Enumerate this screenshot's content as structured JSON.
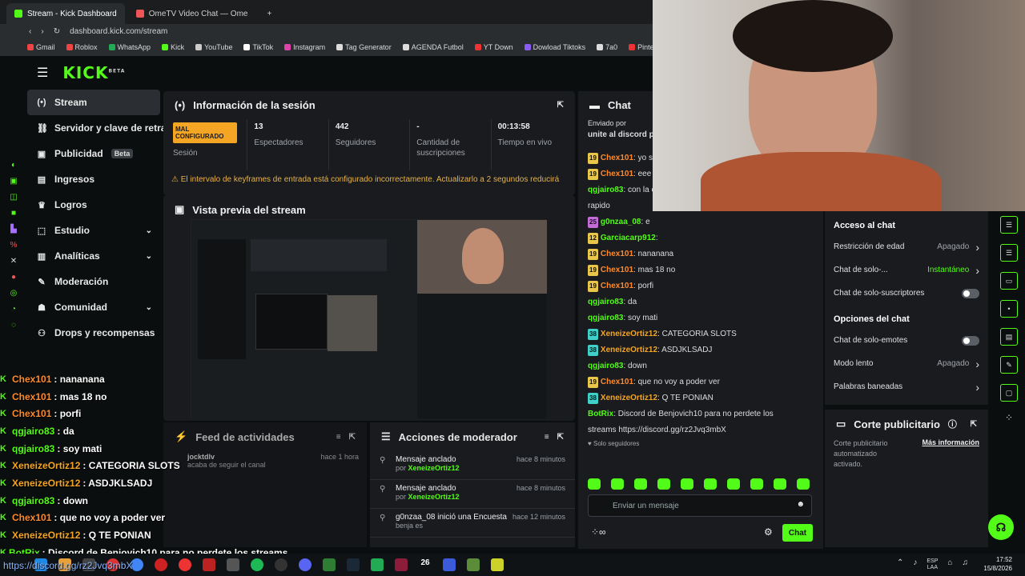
{
  "browser": {
    "tabs": [
      {
        "label": "Stream - Kick Dashboard"
      },
      {
        "label": "OmeTV Video Chat — Ome"
      }
    ],
    "url": "dashboard.kick.com/stream",
    "bookmarks": [
      "Gmail",
      "Roblox",
      "WhatsApp",
      "Kick",
      "YouTube",
      "TikTok",
      "Instagram",
      "Tag Generator",
      "AGENDA Futbol",
      "YT Down",
      "Dowload Tiktoks",
      "7a0",
      "Pinterest"
    ]
  },
  "kick": {
    "logo": "KICK",
    "beta": "BETA"
  },
  "sidebar": {
    "items": [
      {
        "label": "Stream",
        "icon": "broadcast-icon",
        "icon_glyph": "(•)"
      },
      {
        "label": "Servidor y clave de retransmisión",
        "icon": "link-icon",
        "icon_glyph": "⛓"
      },
      {
        "label": "Publicidad",
        "badge": "Beta",
        "icon": "ad-icon",
        "icon_glyph": "▣"
      },
      {
        "label": "Ingresos",
        "icon": "money-icon",
        "icon_glyph": "▤"
      },
      {
        "label": "Logros",
        "icon": "trophy-icon",
        "icon_glyph": "♛"
      },
      {
        "label": "Estudio",
        "icon": "studio-icon",
        "icon_glyph": "⬚"
      },
      {
        "label": "Analíticas",
        "icon": "analytics-icon",
        "icon_glyph": "▥"
      },
      {
        "label": "Moderación",
        "icon": "wrench-icon",
        "icon_glyph": "✎"
      },
      {
        "label": "Comunidad",
        "icon": "community-icon",
        "icon_glyph": "☗"
      },
      {
        "label": "Drops y recompensas",
        "icon": "drops-icon",
        "icon_glyph": "⚇"
      }
    ]
  },
  "session": {
    "title": "Información de la sesión",
    "status_badge": "MAL CONFIGURADO",
    "status_label": "Sesión",
    "stats": [
      {
        "value": "13",
        "label": "Espectadores"
      },
      {
        "value": "442",
        "label": "Seguidores"
      },
      {
        "value": "-",
        "label": "Cantidad de suscripciones"
      },
      {
        "value": "00:13:58",
        "label": "Tiempo en vivo"
      }
    ],
    "warning": "El intervalo de keyframes de entrada está configurado incorrectamente. Actualizarlo a 2 segundos reducirá"
  },
  "preview": {
    "title": "Vista previa del stream"
  },
  "feed": {
    "title": "Feed de actividades",
    "items": [
      {
        "user": "jocktdlv",
        "text": "acaba de seguir el canal",
        "time": "hace 1 hora"
      }
    ]
  },
  "modactions": {
    "title": "Acciones de moderador",
    "items": [
      {
        "text": "Mensaje anclado",
        "by": "por",
        "user": "XeneizeOrtiz12",
        "time": "hace 8 minutos"
      },
      {
        "text": "Mensaje anclado",
        "by": "por",
        "user": "XeneizeOrtiz12",
        "time": "hace 8 minutos"
      },
      {
        "text": "g0nzaa_08 inició una Encuesta",
        "by": "benja es",
        "user": "",
        "time": "hace 12 minutos"
      }
    ]
  },
  "chat": {
    "title": "Chat",
    "pinned_by": "Enviado por",
    "pinned_text": "unite al discord pi",
    "messages": [
      {
        "badge": "19",
        "user": "Chex101",
        "color": "#ff8a2a",
        "text": "yo si"
      },
      {
        "badge": "19",
        "user": "Chex101",
        "color": "#ff8a2a",
        "text": "eee"
      },
      {
        "badge": "",
        "user": "qgjairo83",
        "color": "#53fc18",
        "text": "con la cen... quien sera que te salio"
      },
      {
        "badge": "",
        "user": "",
        "color": "#ddd",
        "text": "rapido"
      },
      {
        "badge": "25",
        "user": "g0nzaa_08",
        "color": "#53fc18",
        "text": "e"
      },
      {
        "badge": "12",
        "user": "Garciacarp912",
        "color": "#53fc18",
        "text": ""
      },
      {
        "badge": "19",
        "user": "Chex101",
        "color": "#ff8a2a",
        "text": "nananana"
      },
      {
        "badge": "19",
        "user": "Chex101",
        "color": "#ff8a2a",
        "text": "mas 18 no"
      },
      {
        "badge": "19",
        "user": "Chex101",
        "color": "#ff8a2a",
        "text": "porfi"
      },
      {
        "badge": "",
        "user": "qgjairo83",
        "color": "#53fc18",
        "text": "da"
      },
      {
        "badge": "",
        "user": "qgjairo83",
        "color": "#53fc18",
        "text": "soy mati"
      },
      {
        "badge": "38",
        "user": "XeneizeOrtiz12",
        "color": "#f5a524",
        "text": "CATEGORIA SLOTS"
      },
      {
        "badge": "38",
        "user": "XeneizeOrtiz12",
        "color": "#f5a524",
        "text": "ASDJKLSADJ"
      },
      {
        "badge": "",
        "user": "qgjairo83",
        "color": "#53fc18",
        "text": "down"
      },
      {
        "badge": "19",
        "user": "Chex101",
        "color": "#ff8a2a",
        "text": "que no voy a poder ver"
      },
      {
        "badge": "38",
        "user": "XeneizeOrtiz12",
        "color": "#f5a524",
        "text": "Q TE PONIAN"
      },
      {
        "badge": "",
        "user": "BotRix",
        "color": "#53fc18",
        "text": "Discord de Benjovich10 para no perdete los"
      },
      {
        "badge": "",
        "user": "",
        "color": "#ddd",
        "text": "streams https://discord.gg/rz2Jvq3mbX"
      }
    ],
    "followers_only": "Solo seguidores",
    "placeholder": "Enviar un mensaje",
    "send_label": "Chat"
  },
  "settings": {
    "access_title": "Acceso al chat",
    "rows1": [
      {
        "label": "Restricción de edad",
        "value": "Apagado",
        "type": "link"
      },
      {
        "label": "Chat de solo-...",
        "value": "Instantáneo",
        "type": "link"
      },
      {
        "label": "Chat de solo-suscriptores",
        "value": "",
        "type": "toggle"
      }
    ],
    "options_title": "Opciones del chat",
    "rows2": [
      {
        "label": "Chat de solo-emotes",
        "value": "",
        "type": "toggle"
      },
      {
        "label": "Modo lento",
        "value": "Apagado",
        "type": "link"
      },
      {
        "label": "Palabras baneadas",
        "value": "",
        "type": "link"
      }
    ],
    "ad_title": "Corte publicitario",
    "ad_desc": "Corte publicitario automatizado activado.",
    "ad_more": "Más información"
  },
  "overlay": [
    {
      "user": "Chex101",
      "color": "#ff8a2a",
      "text": ": nananana"
    },
    {
      "user": "Chex101",
      "color": "#ff8a2a",
      "text": ": mas 18 no"
    },
    {
      "user": "Chex101",
      "color": "#ff8a2a",
      "text": ": porfi"
    },
    {
      "user": "qgjairo83",
      "color": "#53fc18",
      "text": ": da"
    },
    {
      "user": "qgjairo83",
      "color": "#53fc18",
      "text": ": soy mati"
    },
    {
      "user": "XeneizeOrtiz12",
      "color": "#f5a524",
      "text": ": CATEGORIA SLOTS"
    },
    {
      "user": "XeneizeOrtiz12",
      "color": "#f5a524",
      "text": ": ASDJKLSADJ"
    },
    {
      "user": "qgjairo83",
      "color": "#53fc18",
      "text": ": down"
    },
    {
      "user": "Chex101",
      "color": "#ff8a2a",
      "text": ": que no voy a poder ver"
    },
    {
      "user": "XeneizeOrtiz12",
      "color": "#f5a524",
      "text": ": Q TE PONIAN"
    },
    {
      "user": "BotRix",
      "color": "#53fc18",
      "text": ": Discord de Benjovich10 para no perdete los streams"
    }
  ],
  "overlay_link": "https://discord.gg/rz2Jvq3mbX",
  "taskbar": {
    "lang1": "ESP",
    "lang2": "LAA",
    "time": "17:52",
    "date": "15/8/2026",
    "badge": "26"
  },
  "colors": {
    "accent": "#53fc18",
    "warning": "#f5a524",
    "panel": "#191b1f"
  }
}
